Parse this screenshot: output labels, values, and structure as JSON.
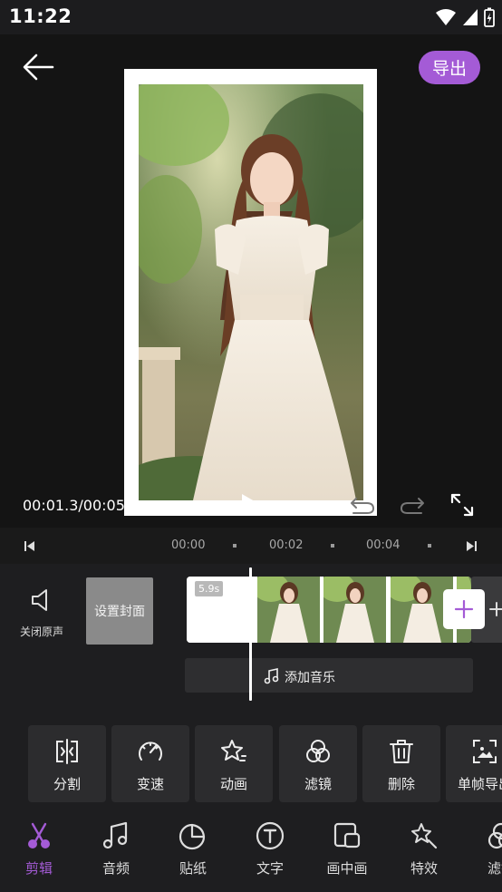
{
  "status_bar": {
    "time": "11:22"
  },
  "header": {
    "export_label": "导出"
  },
  "playback": {
    "timecode": "00:01.3/00:05"
  },
  "ruler": {
    "labels": [
      "00:00",
      "00:02",
      "00:04"
    ]
  },
  "timeline": {
    "mute_label": "关闭原声",
    "cover_label": "设置封面",
    "clip_duration": "5.9s",
    "add_music_label": "添加音乐"
  },
  "tools": [
    {
      "label": "分割",
      "icon": "split-icon"
    },
    {
      "label": "变速",
      "icon": "speed-icon"
    },
    {
      "label": "动画",
      "icon": "animation-icon"
    },
    {
      "label": "滤镜",
      "icon": "filter-icon"
    },
    {
      "label": "删除",
      "icon": "delete-icon"
    },
    {
      "label": "单帧导出",
      "icon": "frame-export-icon"
    }
  ],
  "tabs": [
    {
      "label": "剪辑",
      "icon": "scissors-icon",
      "active": true
    },
    {
      "label": "音频",
      "icon": "music-note-icon"
    },
    {
      "label": "贴纸",
      "icon": "sticker-icon"
    },
    {
      "label": "文字",
      "icon": "text-icon"
    },
    {
      "label": "画中画",
      "icon": "picture-in-picture-icon"
    },
    {
      "label": "特效",
      "icon": "effects-icon"
    },
    {
      "label": "滤镜",
      "icon": "filter-icon"
    }
  ],
  "colors": {
    "accent": "#a45bd6",
    "background": "#1c1c1e",
    "tool_bg": "#2c2c2e"
  }
}
